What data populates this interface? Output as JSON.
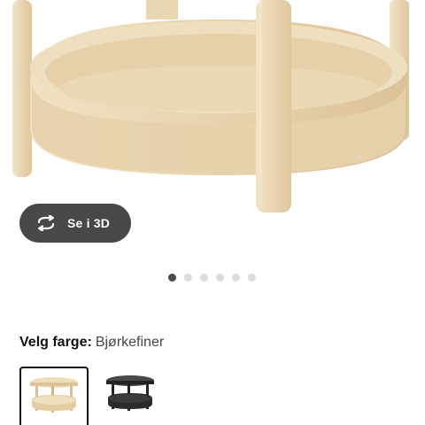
{
  "product": {
    "image_icon": "birch-round-side-table-photo",
    "view_3d": {
      "label": "Se i 3D",
      "icon": "rotate-3d-icon"
    },
    "carousel": {
      "count": 6,
      "active_index": 0
    },
    "color_select": {
      "label": "Velg farge:",
      "value": "Bjørkefiner",
      "options": [
        {
          "name": "birch-veneer",
          "selected": true
        },
        {
          "name": "black",
          "selected": false
        }
      ]
    }
  },
  "colors": {
    "birch_light": "#eedcbb",
    "birch_mid": "#e2c9a0",
    "birch_dark": "#cfb084",
    "button_bg": "#484848",
    "black_table": "#2b2b2b",
    "dot_active": "#4a4a4a",
    "dot_inactive": "#dcdcdc"
  }
}
